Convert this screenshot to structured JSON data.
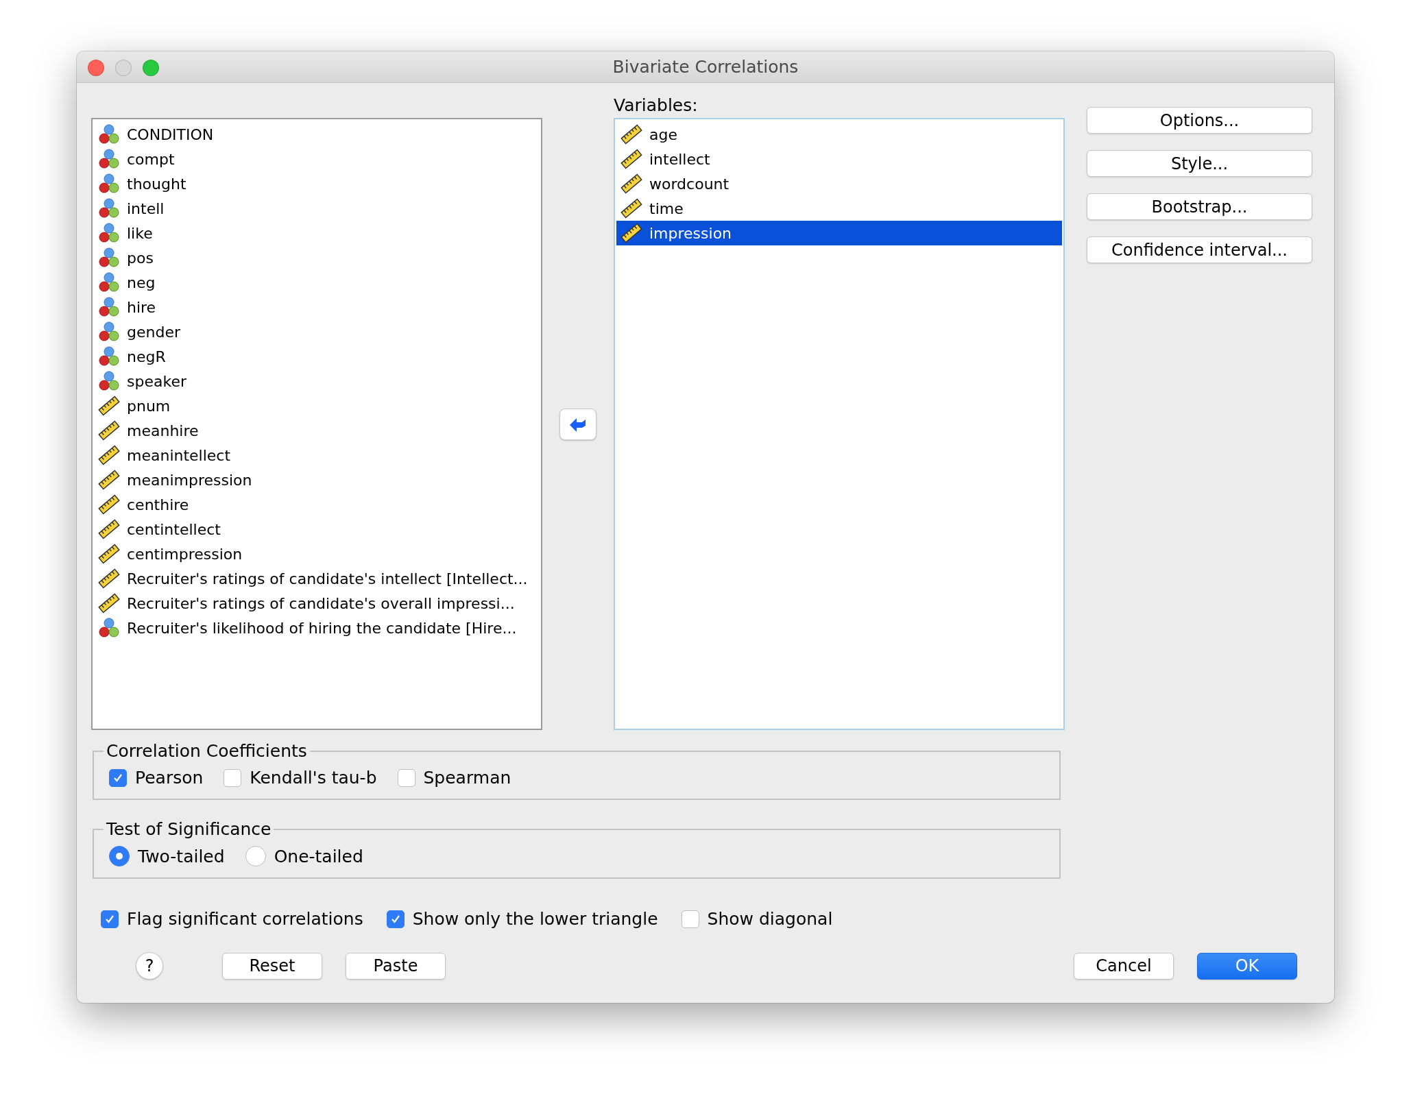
{
  "window": {
    "title": "Bivariate Correlations"
  },
  "source_list": [
    {
      "name": "CONDITION",
      "kind": "nominal",
      "selected": false
    },
    {
      "name": "compt",
      "kind": "nominal",
      "selected": false
    },
    {
      "name": "thought",
      "kind": "nominal",
      "selected": false
    },
    {
      "name": "intell",
      "kind": "nominal",
      "selected": false
    },
    {
      "name": "like",
      "kind": "nominal",
      "selected": false
    },
    {
      "name": "pos",
      "kind": "nominal",
      "selected": false
    },
    {
      "name": "neg",
      "kind": "nominal",
      "selected": false
    },
    {
      "name": "hire",
      "kind": "nominal",
      "selected": false
    },
    {
      "name": "gender",
      "kind": "nominal",
      "selected": false
    },
    {
      "name": "negR",
      "kind": "nominal",
      "selected": false
    },
    {
      "name": "speaker",
      "kind": "nominal",
      "selected": false
    },
    {
      "name": "pnum",
      "kind": "scale",
      "selected": false
    },
    {
      "name": "meanhire",
      "kind": "scale",
      "selected": false
    },
    {
      "name": "meanintellect",
      "kind": "scale",
      "selected": false
    },
    {
      "name": "meanimpression",
      "kind": "scale",
      "selected": false
    },
    {
      "name": "centhire",
      "kind": "scale",
      "selected": false
    },
    {
      "name": "centintellect",
      "kind": "scale",
      "selected": false
    },
    {
      "name": "centimpression",
      "kind": "scale",
      "selected": false
    },
    {
      "name": "Recruiter's ratings of candidate's intellect [Intellect...",
      "kind": "scale",
      "selected": false
    },
    {
      "name": "Recruiter's ratings of candidate's overall impressi...",
      "kind": "scale",
      "selected": false
    },
    {
      "name": "Recruiter's likelihood of hiring the candidate [Hire...",
      "kind": "nominal",
      "selected": false
    }
  ],
  "variables": {
    "label": "Variables:",
    "items": [
      {
        "name": "age",
        "kind": "scale",
        "selected": false
      },
      {
        "name": "intellect",
        "kind": "scale",
        "selected": false
      },
      {
        "name": "wordcount",
        "kind": "scale",
        "selected": false
      },
      {
        "name": "time",
        "kind": "scale",
        "selected": false
      },
      {
        "name": "impression",
        "kind": "scale",
        "selected": true
      }
    ]
  },
  "side_buttons": [
    "Options...",
    "Style...",
    "Bootstrap...",
    "Confidence interval..."
  ],
  "correlation_coefficients": {
    "title": "Correlation Coefficients",
    "options": [
      {
        "label": "Pearson",
        "checked": true
      },
      {
        "label": "Kendall's tau-b",
        "checked": false
      },
      {
        "label": "Spearman",
        "checked": false
      }
    ]
  },
  "test_of_significance": {
    "title": "Test of Significance",
    "options": [
      {
        "label": "Two-tailed",
        "selected": true
      },
      {
        "label": "One-tailed",
        "selected": false
      }
    ]
  },
  "flags": [
    {
      "label": "Flag significant correlations",
      "checked": true
    },
    {
      "label": "Show only the lower triangle",
      "checked": true
    },
    {
      "label": "Show diagonal",
      "checked": false
    }
  ],
  "help": "?",
  "left_buttons": [
    "Reset",
    "Paste"
  ],
  "cancel": "Cancel",
  "ok": "OK"
}
